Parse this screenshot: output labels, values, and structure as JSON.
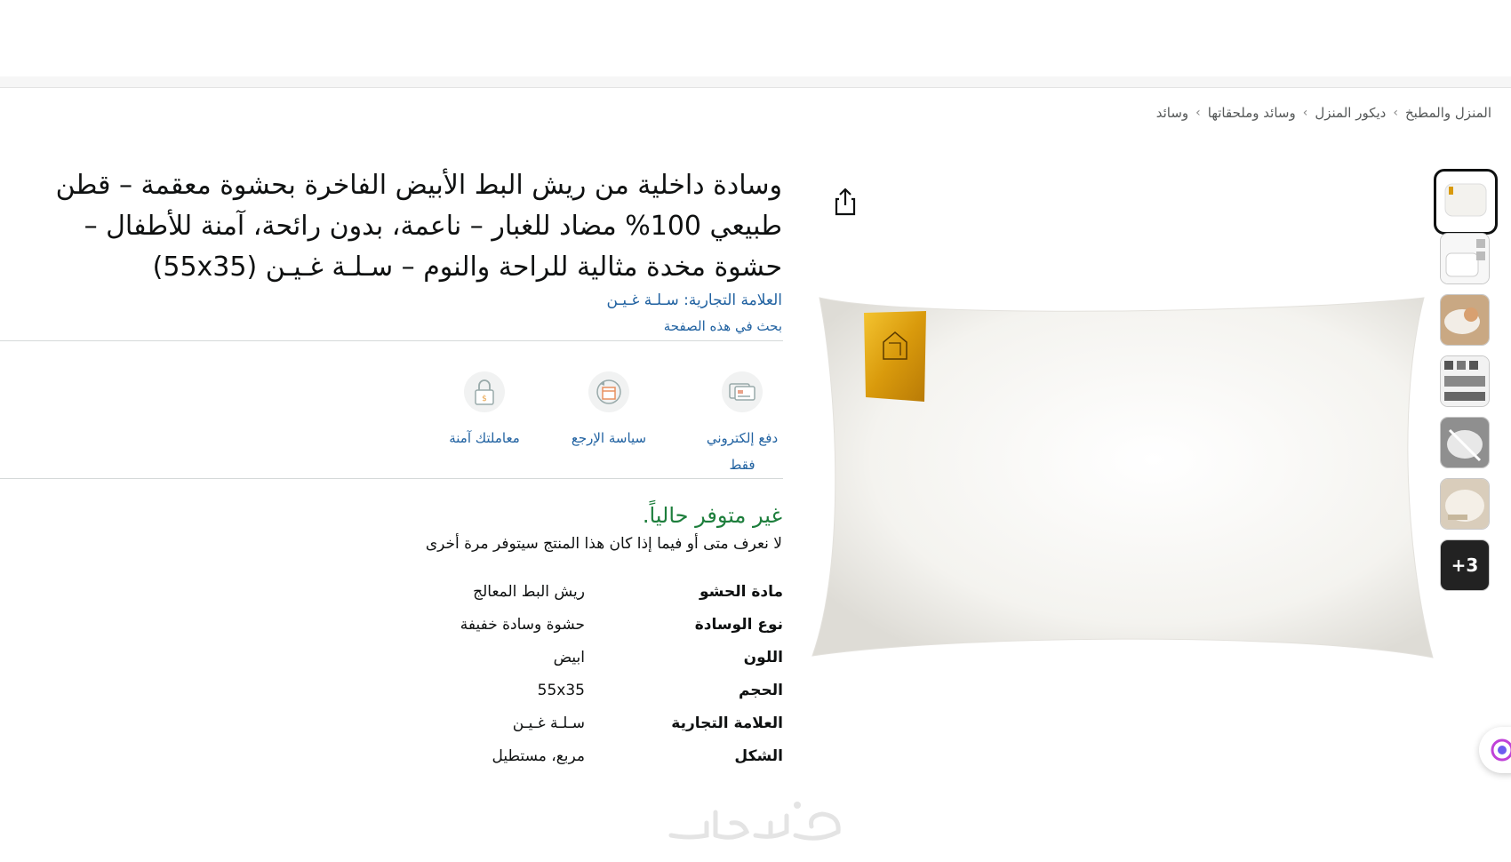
{
  "breadcrumb": [
    "المنزل والمطبخ",
    "ديكور المنزل",
    "وسائد وملحقاتها",
    "وسائد"
  ],
  "breadcrumb_separator": "›",
  "product": {
    "title": "وسادة داخلية من ريش البط الأبيض الفاخرة بحشوة معقمة – قطن طبيعي 100% مضاد للغبار – ناعمة، بدون رائحة، آمنة للأطفال – حشوة مخدة مثالية للراحة والنوم – سـلـة غـيـن (55x35)",
    "brand_line": "العلامة التجارية: سـلـة غـيـن",
    "search_page": "بحث في هذه الصفحة"
  },
  "features": [
    {
      "label": "دفع إلكتروني فقط",
      "icon": "card-payment-icon"
    },
    {
      "label": "سياسة الإرجع",
      "icon": "return-box-icon"
    },
    {
      "label": "معاملتك آمنة",
      "icon": "secure-lock-icon"
    }
  ],
  "availability": {
    "status": "غير متوفر حالياً.",
    "note": "لا نعرف متى أو فيما إذا كان هذا المنتج سيتوفر مرة أخرى"
  },
  "specs": [
    {
      "key": "مادة الحشو",
      "value": "ريش البط المعالج"
    },
    {
      "key": "نوع الوسادة",
      "value": "حشوة وسادة خفيفة"
    },
    {
      "key": "اللون",
      "value": "ابيض"
    },
    {
      "key": "الحجم",
      "value": "55x35"
    },
    {
      "key": "العلامة التجارية",
      "value": "سـلـة غـيـن"
    },
    {
      "key": "الشكل",
      "value": "مربع، مستطيل"
    }
  ],
  "gallery": {
    "more_count": "+3",
    "thumb_count": 7,
    "selected_index": 0
  },
  "colors": {
    "link": "#2162a1",
    "available_green": "#1d7e3c",
    "label_gold": "#e0a70f"
  }
}
